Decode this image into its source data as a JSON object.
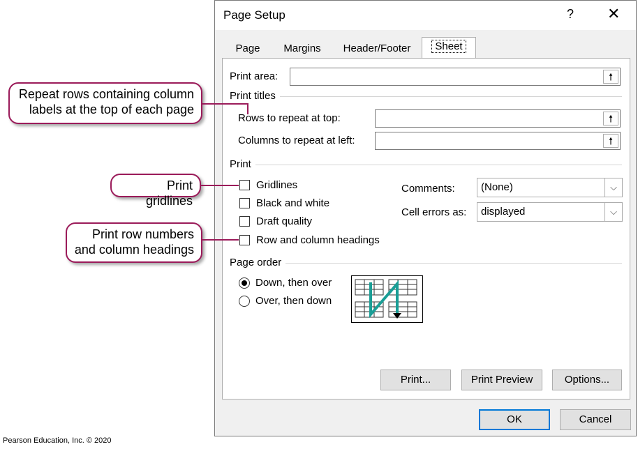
{
  "dialog": {
    "title": "Page Setup",
    "help": "?",
    "close": "✕",
    "tabs": [
      "Page",
      "Margins",
      "Header/Footer",
      "Sheet"
    ],
    "active_tab": "Sheet"
  },
  "sheet": {
    "print_area_label": "Print area:",
    "print_titles_group": "Print titles",
    "rows_repeat_label": "Rows to repeat at top:",
    "cols_repeat_label": "Columns to repeat at left:",
    "print_group": "Print",
    "gridlines_label": "Gridlines",
    "black_white_label": "Black and white",
    "draft_quality_label": "Draft quality",
    "row_col_headings_label": "Row and column headings",
    "comments_label": "Comments:",
    "comments_value": "(None)",
    "cell_errors_label": "Cell errors as:",
    "cell_errors_value": "displayed",
    "page_order_group": "Page order",
    "down_then_over_label": "Down, then over",
    "over_then_down_label": "Over, then down",
    "print_btn": "Print...",
    "print_preview_btn": "Print Preview",
    "options_btn": "Options..."
  },
  "footer": {
    "ok": "OK",
    "cancel": "Cancel"
  },
  "callouts": {
    "repeat_rows": "Repeat rows containing column labels at the top of each page",
    "gridlines": "Print gridlines",
    "row_numbers": "Print row numbers and column headings"
  },
  "credit": "Pearson Education, Inc. © 2020",
  "colors": {
    "callout_border": "#9b1b5a",
    "accent": "#0078d7",
    "page_order_arrow": "#1a9e96"
  }
}
